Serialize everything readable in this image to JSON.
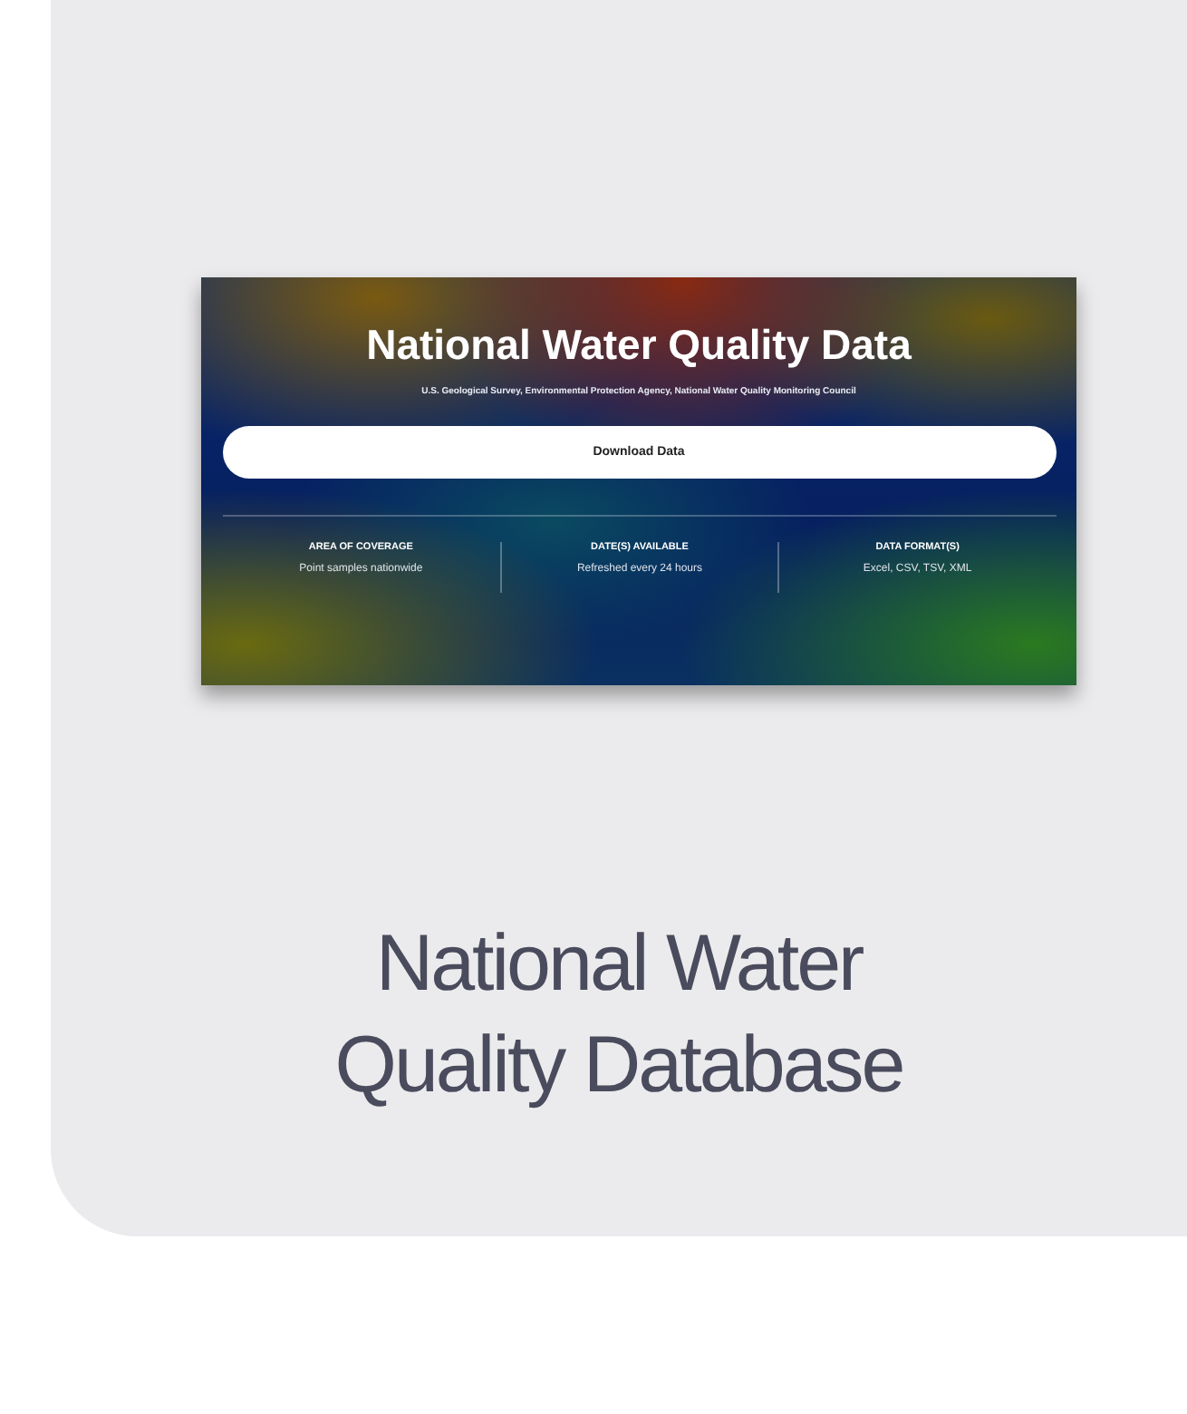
{
  "preview": {
    "title": "National Water Quality Data",
    "subtitle": "U.S. Geological Survey, Environmental Protection Agency, National Water Quality Monitoring Council",
    "button": "Download Data",
    "stats": [
      {
        "label": "AREA OF COVERAGE",
        "value": "Point samples nationwide"
      },
      {
        "label": "DATE(S) AVAILABLE",
        "value": "Refreshed every 24 hours"
      },
      {
        "label": "DATA FORMAT(S)",
        "value": "Excel, CSV, TSV, XML"
      }
    ]
  },
  "card": {
    "title": "National Water Quality Database"
  }
}
